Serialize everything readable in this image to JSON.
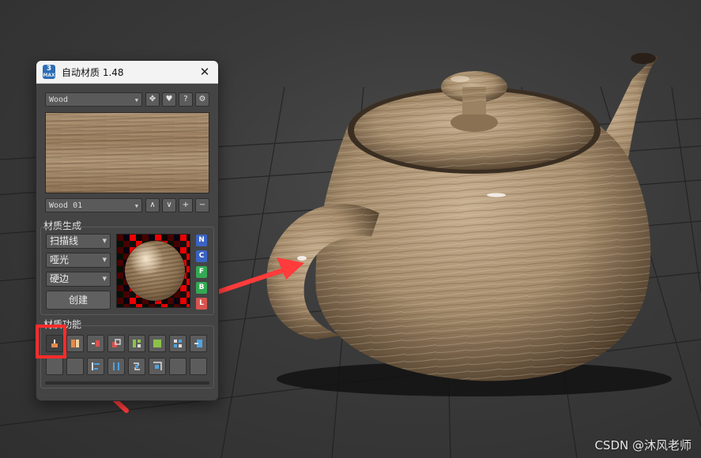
{
  "dialog": {
    "title": "自动材质 1.48",
    "app_icon_text": "3",
    "app_icon_sub": "MAX",
    "close_glyph": "✕"
  },
  "library": {
    "selected": "Wood",
    "buttons": [
      "✥",
      "♥",
      "?",
      "⚙"
    ]
  },
  "variant": {
    "selected": "Wood 01",
    "buttons": [
      "∧",
      "∨",
      "+",
      "−"
    ]
  },
  "generate": {
    "section_label": "材质生成",
    "mapping_type": "扫描线",
    "gloss": "哑光",
    "edge": "硬边",
    "create_label": "创建",
    "map_buttons": [
      {
        "label": "N",
        "color": "#3b63c4"
      },
      {
        "label": "C",
        "color": "#3b63c4"
      },
      {
        "label": "F",
        "color": "#34a853"
      },
      {
        "label": "B",
        "color": "#34a853"
      },
      {
        "label": "L",
        "color": "#d9534f"
      }
    ]
  },
  "functions": {
    "section_label": "材质功能"
  },
  "watermark": "CSDN @沐风老师"
}
